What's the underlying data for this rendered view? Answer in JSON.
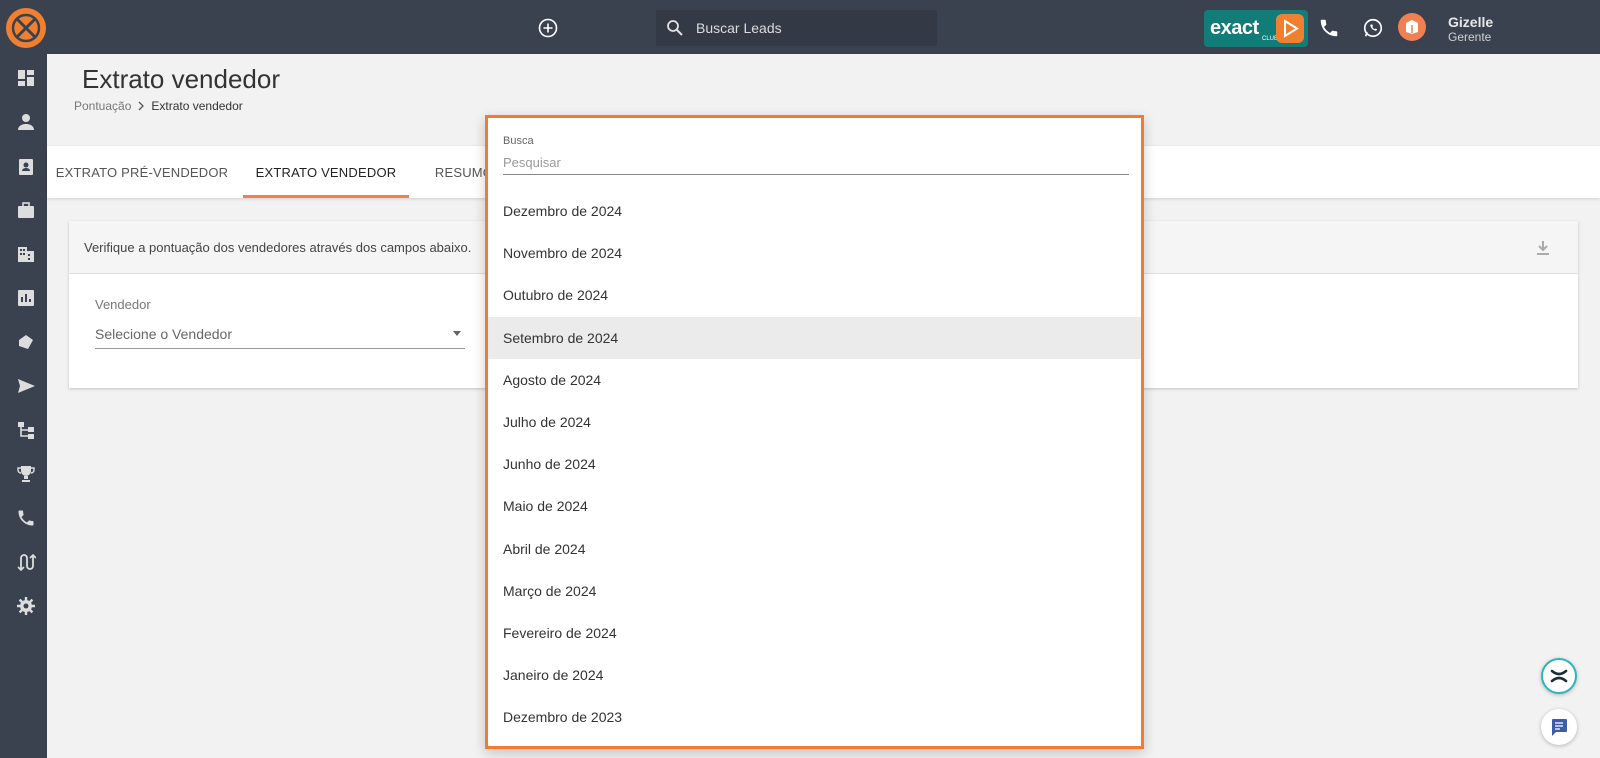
{
  "topbar": {
    "add_icon": "plus-circle-icon",
    "search_placeholder": "Buscar Leads",
    "club_brand": "exact",
    "club_sub": "CLUB",
    "user_name": "Gizelle",
    "user_role": "Gerente"
  },
  "sidebar": {
    "items": [
      "dashboard-icon",
      "person-icon",
      "contact-card-icon",
      "briefcase-icon",
      "building-icon",
      "bar-chart-icon",
      "tags-icon",
      "send-icon",
      "hierarchy-icon",
      "trophy-icon",
      "phone-icon",
      "flow-icon",
      "gear-icon"
    ]
  },
  "header": {
    "title": "Extrato vendedor",
    "breadcrumb_parent": "Pontuação",
    "breadcrumb_current": "Extrato vendedor"
  },
  "tabs": [
    {
      "label": "EXTRATO PRÉ-VENDEDOR"
    },
    {
      "label": "EXTRATO VENDEDOR"
    },
    {
      "label": "RESUMO"
    }
  ],
  "card": {
    "info": "Verifique a pontuação dos vendedores através dos campos abaixo.",
    "vendedor_label": "Vendedor",
    "vendedor_value": "Selecione o Vendedor"
  },
  "dropdown": {
    "search_label": "Busca",
    "search_placeholder": "Pesquisar",
    "highlighted_index": 3,
    "options": [
      "Dezembro de 2024",
      "Novembro de 2024",
      "Outubro de 2024",
      "Setembro de 2024",
      "Agosto de 2024",
      "Julho de 2024",
      "Junho de 2024",
      "Maio de 2024",
      "Abril de 2024",
      "Março de 2024",
      "Fevereiro de 2024",
      "Janeiro de 2024",
      "Dezembro de 2023"
    ]
  },
  "colors": {
    "topbar": "#3a4250",
    "accent": "#f07c30",
    "brand_teal": "#127c79"
  }
}
